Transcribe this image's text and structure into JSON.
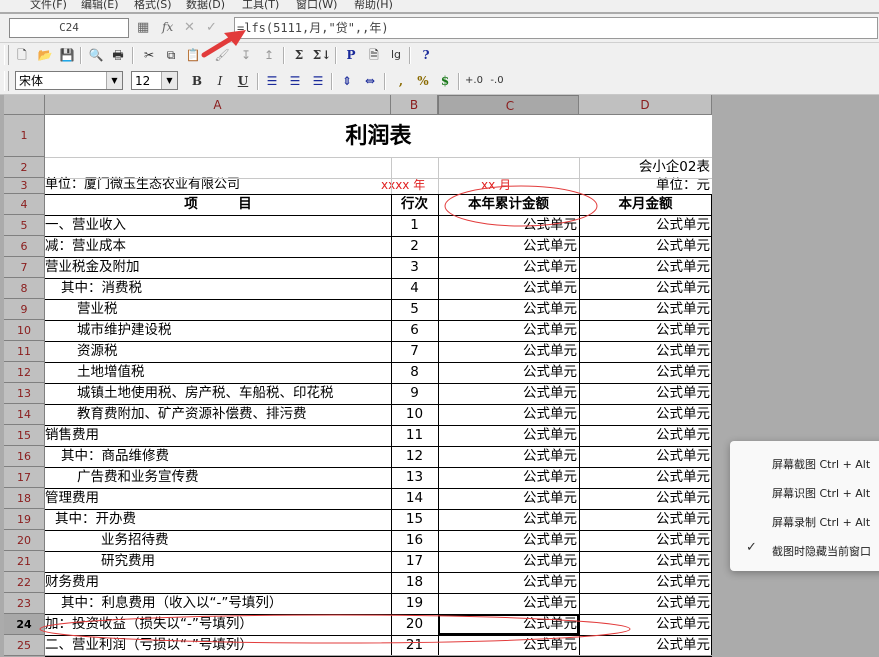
{
  "menu": [
    "文件(F)",
    "编辑(E)",
    "格式(S)",
    "数据(D)",
    "工具(T)",
    "窗口(W)",
    "帮助(H)"
  ],
  "formula_bar": {
    "cell_ref": "C24",
    "formula": "=lfs(5111,月,\"贷\",,年)",
    "fx": "fx"
  },
  "toolbar2": {
    "font": "宋体",
    "size": "12",
    "bold": "B",
    "italic": "I",
    "underline": "U",
    "comma": ",",
    "percent": "%",
    "currency": "$"
  },
  "toolbar1": {
    "p": "P",
    "lg": "lg",
    "help": "?"
  },
  "columns": [
    "A",
    "B",
    "C",
    "D"
  ],
  "row_numbers": [
    "1",
    "2",
    "3",
    "4",
    "5",
    "6",
    "7",
    "8",
    "9",
    "10",
    "11",
    "12",
    "13",
    "14",
    "15",
    "16",
    "17",
    "18",
    "19",
    "20",
    "21",
    "22",
    "23",
    "24",
    "25"
  ],
  "report": {
    "title": "利润表",
    "form_code": "会小企02表",
    "unit_label": "单位：厦门微玉生态农业有限公司",
    "year_label": "xxxx 年",
    "month_label": "xx 月",
    "currency_unit": "单位：元",
    "headers": {
      "item": "项　　　目",
      "line": "行次",
      "ytd": "本年累计金额",
      "month": "本月金额"
    },
    "formula_cell": "公式单元",
    "rows": [
      {
        "item": "一、营业收入",
        "line": "1"
      },
      {
        "item": "减：营业成本",
        "line": "2"
      },
      {
        "item": "营业税金及附加",
        "line": "3"
      },
      {
        "item": "其中：消费税",
        "line": "4"
      },
      {
        "item": "营业税",
        "line": "5"
      },
      {
        "item": "城市维护建设税",
        "line": "6"
      },
      {
        "item": "资源税",
        "line": "7"
      },
      {
        "item": "土地增值税",
        "line": "8"
      },
      {
        "item": "城镇土地使用税、房产税、车船税、印花税",
        "line": "9"
      },
      {
        "item": "教育费附加、矿产资源补偿费、排污费",
        "line": "10"
      },
      {
        "item": "销售费用",
        "line": "11"
      },
      {
        "item": "其中：商品维修费",
        "line": "12"
      },
      {
        "item": "广告费和业务宣传费",
        "line": "13"
      },
      {
        "item": "管理费用",
        "line": "14"
      },
      {
        "item": "其中：开办费",
        "line": "15"
      },
      {
        "item": "业务招待费",
        "line": "16"
      },
      {
        "item": "研究费用",
        "line": "17"
      },
      {
        "item": "财务费用",
        "line": "18"
      },
      {
        "item": "其中：利息费用（收入以“-”号填列）",
        "line": "19"
      },
      {
        "item": "加：投资收益（损失以“-”号填列）",
        "line": "20"
      },
      {
        "item": "二、营业利润（亏损以“-”号填列）",
        "line": "21"
      }
    ]
  },
  "context_menu": {
    "items": [
      "屏幕截图 Ctrl + Alt",
      "屏幕识图 Ctrl + Alt",
      "屏幕录制 Ctrl + Alt",
      "截图时隐藏当前窗口"
    ]
  }
}
